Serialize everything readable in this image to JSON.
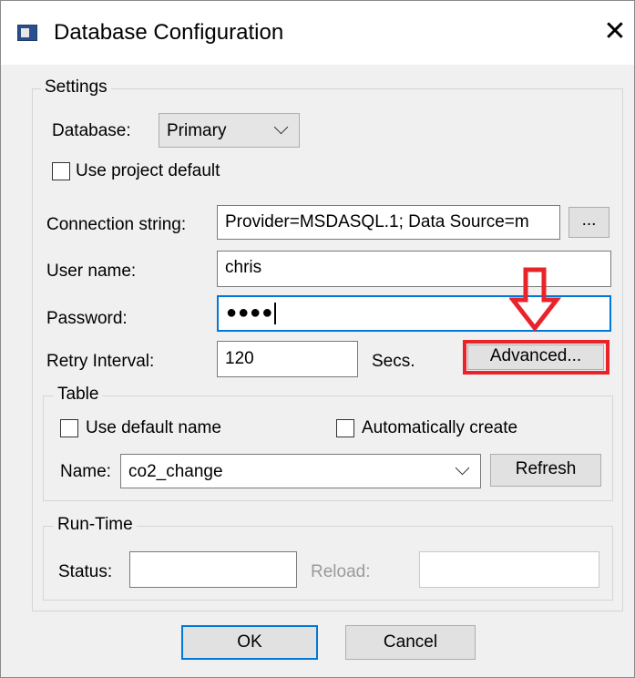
{
  "window": {
    "title": "Database Configuration",
    "close_glyph": "✕"
  },
  "settings": {
    "legend": "Settings",
    "database_label": "Database:",
    "database_value": "Primary",
    "use_project_default": "Use project default",
    "connection_label": "Connection string:",
    "connection_value": "Provider=MSDASQL.1; Data Source=m",
    "browse_label": "...",
    "username_label": "User name:",
    "username_value": "chris",
    "password_label": "Password:",
    "password_mask": "●●●●",
    "retry_label": "Retry Interval:",
    "retry_value": "120",
    "secs_label": "Secs.",
    "advanced_label": "Advanced..."
  },
  "table": {
    "legend": "Table",
    "use_default_name": "Use default name",
    "auto_create": "Automatically create",
    "name_label": "Name:",
    "name_value": "co2_change",
    "refresh_label": "Refresh"
  },
  "runtime": {
    "legend": "Run-Time",
    "status_label": "Status:",
    "status_value": "",
    "reload_label": "Reload:",
    "reload_value": ""
  },
  "footer": {
    "ok_label": "OK",
    "cancel_label": "Cancel"
  },
  "annotation": {
    "highlight_color": "#e8232a"
  },
  "colors": {
    "accent": "#0078d7",
    "window_bg": "#f0f0f0"
  }
}
